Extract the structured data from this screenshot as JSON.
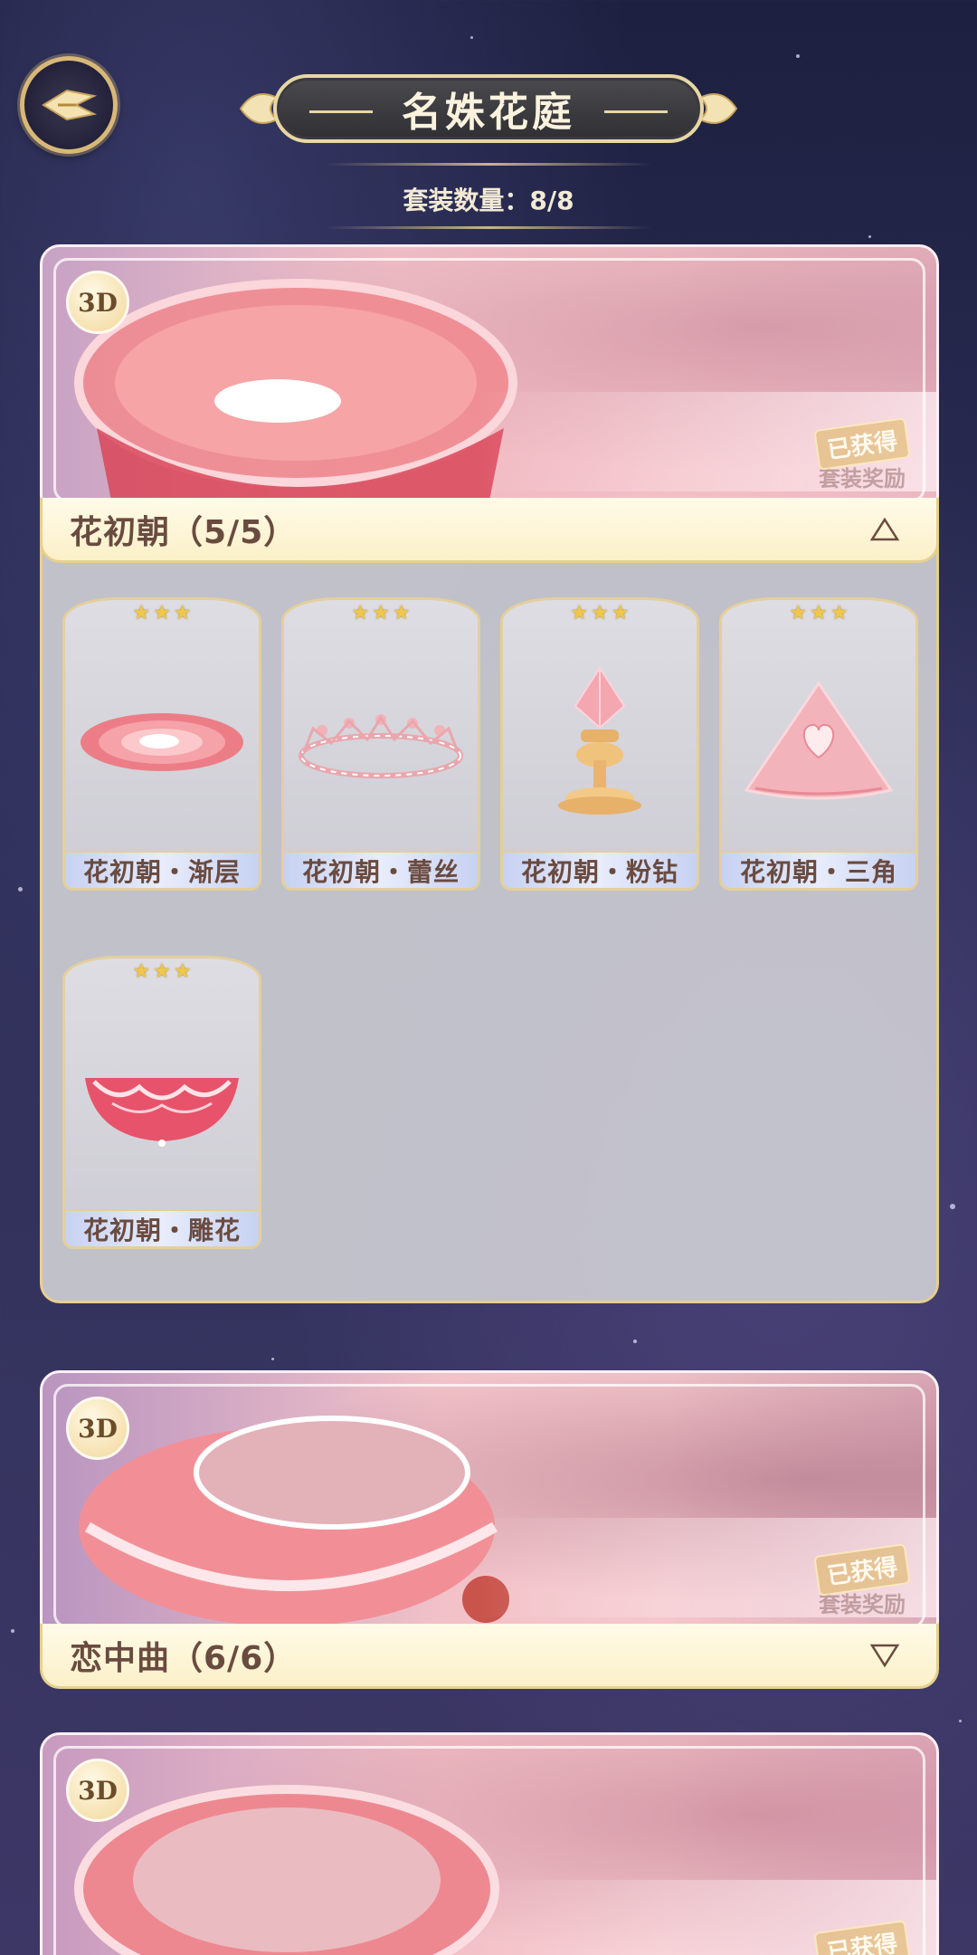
{
  "header": {
    "title": "名姝花庭",
    "count_text": "套装数量：8/8"
  },
  "suits": [
    {
      "name": "花初朝（5/5）",
      "badge": "3D",
      "obtained": "已获得",
      "reward": "套装奖励",
      "expanded": true,
      "items": [
        {
          "label": "花初朝・渐层",
          "stars": 3,
          "icon": "gradient-bowl-icon"
        },
        {
          "label": "花初朝・蕾丝",
          "stars": 3,
          "icon": "lace-crown-icon"
        },
        {
          "label": "花初朝・粉钻",
          "stars": 3,
          "icon": "pink-diamond-icon"
        },
        {
          "label": "花初朝・三角",
          "stars": 3,
          "icon": "heart-triangle-icon"
        },
        {
          "label": "花初朝・雕花",
          "stars": 3,
          "icon": "carved-bowl-icon"
        }
      ]
    },
    {
      "name": "恋中曲（6/6）",
      "badge": "3D",
      "obtained": "已获得",
      "reward": "套装奖励",
      "expanded": false
    },
    {
      "name": "",
      "badge": "3D",
      "obtained": "已获得",
      "expanded": false
    }
  ],
  "colors": {
    "accent_gold": "#e7cf8e",
    "text_brown": "#6a4b40",
    "star_yellow": "#f1c74a"
  }
}
